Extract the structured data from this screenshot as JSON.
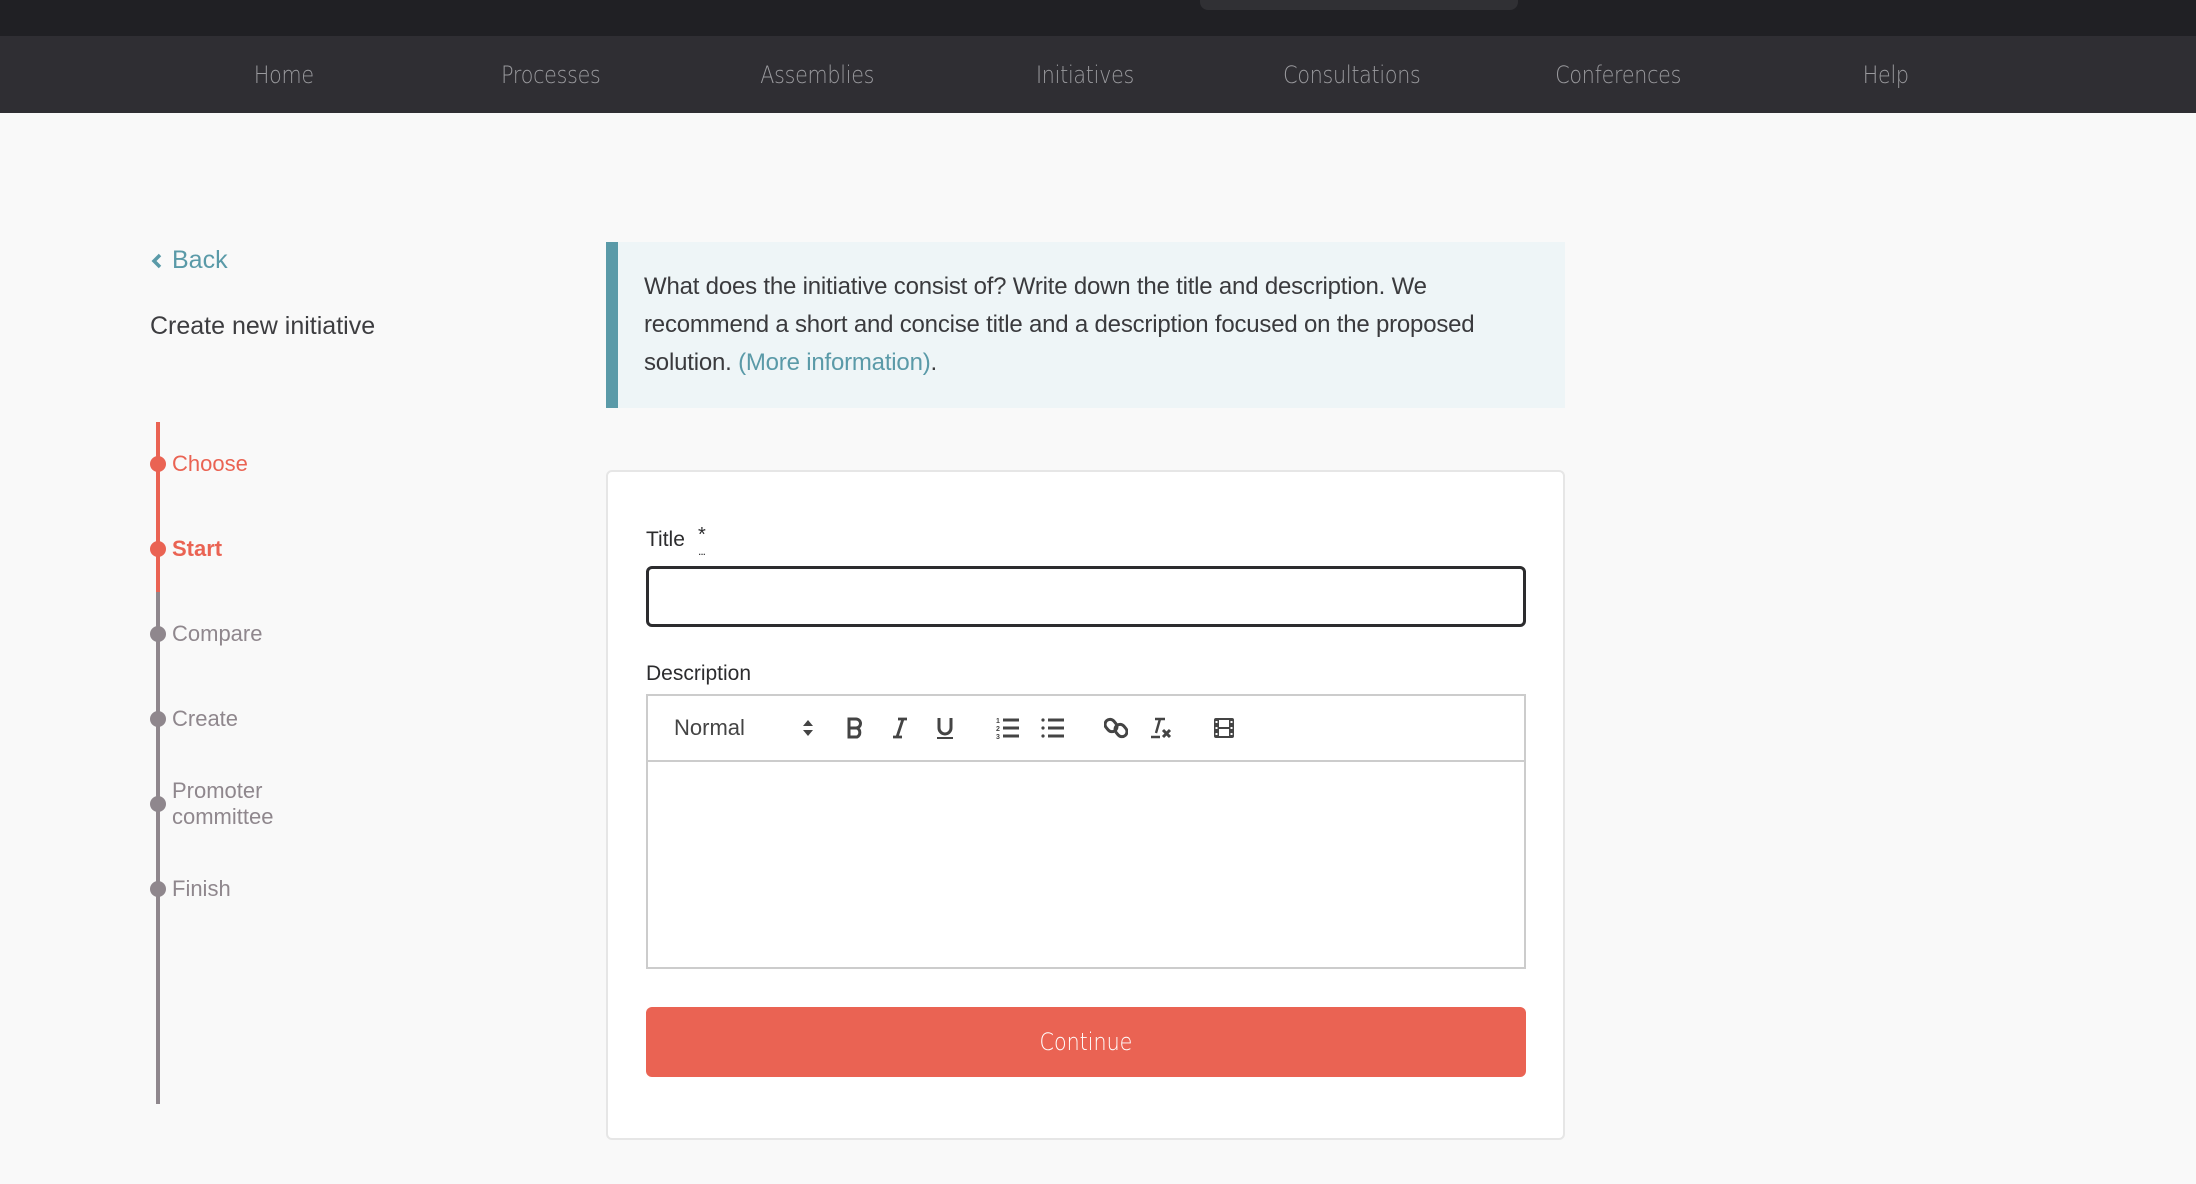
{
  "nav": {
    "items": [
      {
        "label": "Home"
      },
      {
        "label": "Processes"
      },
      {
        "label": "Assemblies"
      },
      {
        "label": "Initiatives"
      },
      {
        "label": "Consultations"
      },
      {
        "label": "Conferences"
      },
      {
        "label": "Help"
      }
    ]
  },
  "sidebar": {
    "back_label": "Back",
    "back_icon": "chevron-left-icon",
    "heading": "Create new initiative",
    "steps": [
      {
        "label": "Choose",
        "state": "done"
      },
      {
        "label": "Start",
        "state": "current"
      },
      {
        "label": "Compare",
        "state": "todo"
      },
      {
        "label": "Create",
        "state": "todo"
      },
      {
        "label": "Promoter committee",
        "state": "todo"
      },
      {
        "label": "Finish",
        "state": "todo"
      }
    ]
  },
  "callout": {
    "text": "What does the initiative consist of? Write down the title and description. We recommend a short and concise title and a description focused on the proposed solution. ",
    "link_label": "(More information)",
    "suffix": "."
  },
  "form": {
    "title_label": "Title",
    "title_required_marker": "*",
    "title_required_hint": "...",
    "title_value": "",
    "description_label": "Description",
    "editor": {
      "format_value": "Normal",
      "buttons": [
        "bold-icon",
        "italic-icon",
        "underline-icon",
        "ordered-list-icon",
        "bullet-list-icon",
        "link-icon",
        "clear-format-icon",
        "video-icon"
      ],
      "body_value": ""
    },
    "continue_label": "Continue"
  },
  "colors": {
    "accent": "#ea6353",
    "link": "#5a9aa8",
    "nav_bg": "#2f2e33",
    "topbar_bg": "#202024",
    "step_inactive": "#8f878d",
    "callout_bg": "#eef5f7"
  }
}
